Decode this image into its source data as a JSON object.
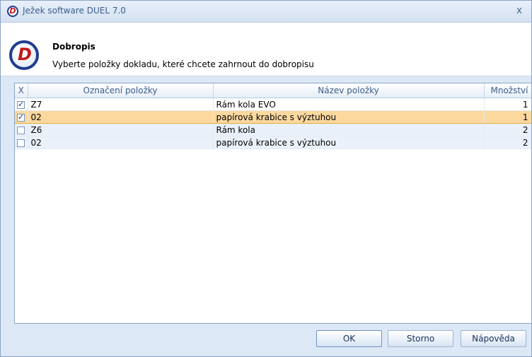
{
  "window": {
    "title": "Ježek software DUEL 7.0",
    "close_glyph": "x"
  },
  "header": {
    "title": "Dobropis",
    "subtitle": "Vyberte položky dokladu, které chcete zahrnout do dobropisu"
  },
  "table": {
    "columns": [
      "X",
      "Označení položky",
      "Název položky",
      "Množství"
    ],
    "rows": [
      {
        "checked": true,
        "code": "Z7",
        "name": "Rám kola EVO",
        "qty": "1"
      },
      {
        "checked": true,
        "code": "02",
        "name": "papírová krabice s výztuhou",
        "qty": "1"
      },
      {
        "checked": false,
        "code": "Z6",
        "name": "Rám kola",
        "qty": "2"
      },
      {
        "checked": false,
        "code": "02",
        "name": "papírová krabice s výztuhou",
        "qty": "2"
      }
    ],
    "selected_index": 1
  },
  "buttons": {
    "ok": "OK",
    "cancel": "Storno",
    "help": "Nápověda"
  },
  "colors": {
    "selected_row": "#fbd89e",
    "logo_ring": "#1f3d8f",
    "logo_letter": "#c41818"
  },
  "icons": {
    "app": "duel-logo-icon",
    "close": "close-icon",
    "checkbox": "checkbox-icon"
  }
}
